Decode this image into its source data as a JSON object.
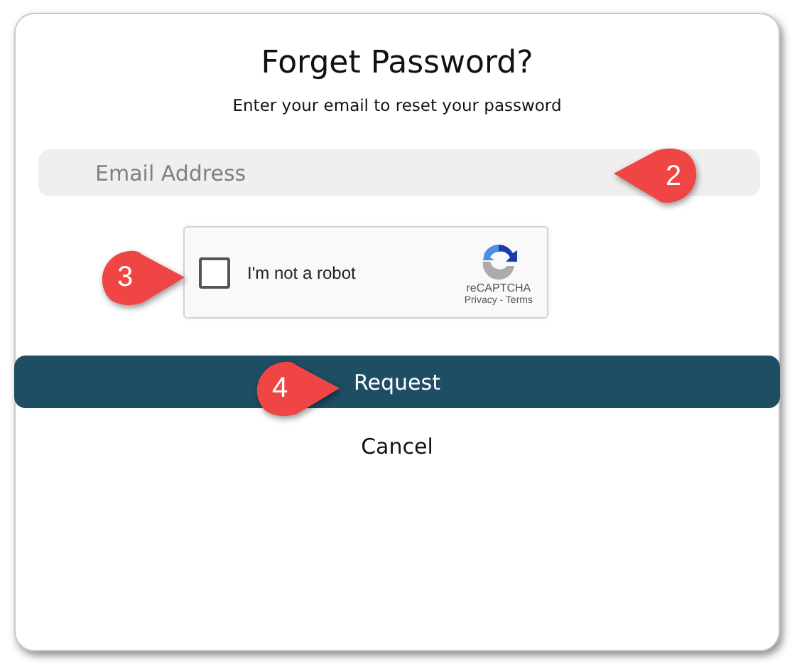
{
  "dialog": {
    "title": "Forget Password?",
    "subtitle": "Enter your email to reset your password",
    "email_field": {
      "placeholder": "Email Address"
    },
    "captcha": {
      "label": "I'm not a robot",
      "checked": false,
      "brand": "reCAPTCHA",
      "links": "Privacy - Terms"
    },
    "buttons": [
      {
        "kind": "primary",
        "label": "Request"
      },
      {
        "kind": "link",
        "label": "Cancel"
      }
    ]
  },
  "callouts": [
    {
      "number": "2",
      "kind": "left"
    },
    {
      "number": "3",
      "kind": "right"
    },
    {
      "number": "4",
      "kind": "right"
    }
  ]
}
